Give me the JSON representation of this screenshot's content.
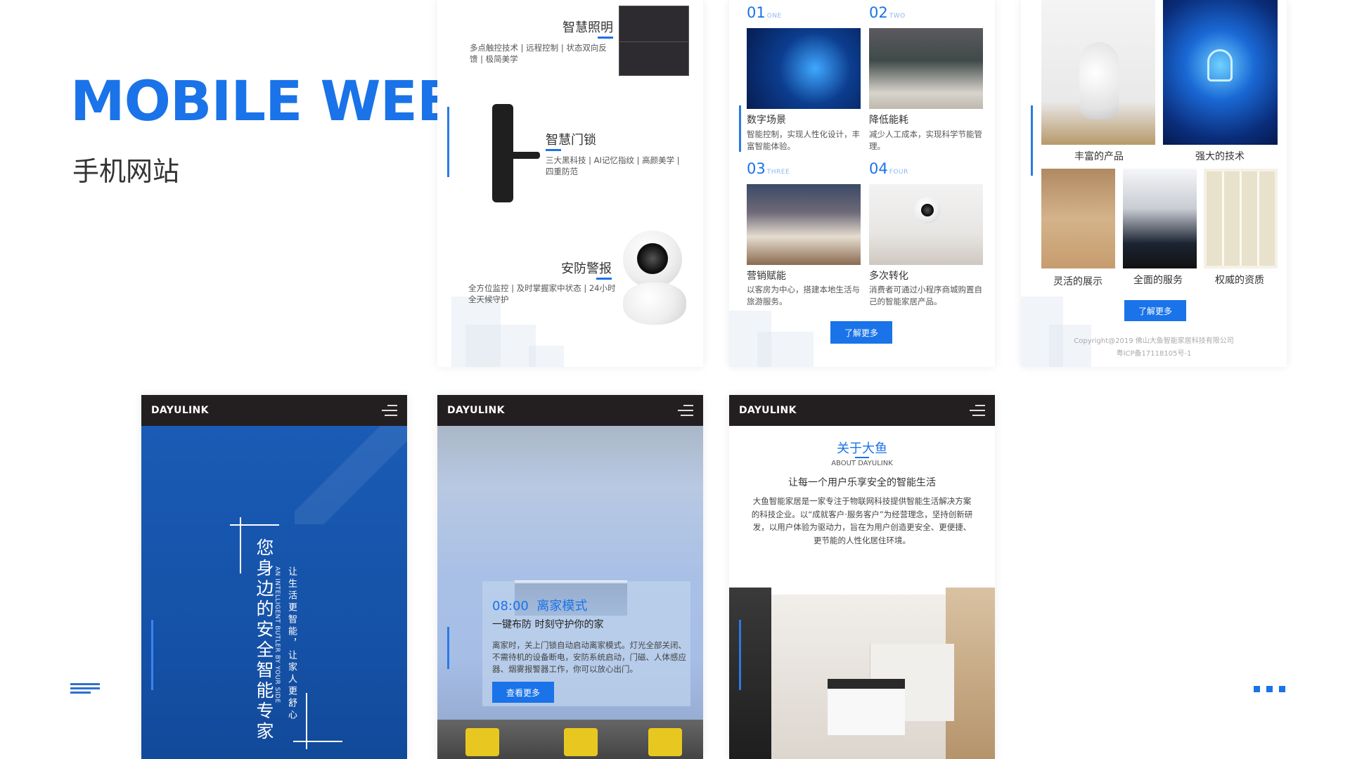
{
  "hero": {
    "title": "MOBILE WEB",
    "subtitle": "手机网站"
  },
  "products": [
    {
      "name": "智慧照明",
      "desc": "多点触控技术 | 远程控制 | 状态双向反馈 | 极简美学"
    },
    {
      "name": "智慧门锁",
      "desc": "三大黑科技 | AI记忆指纹 | 高颜美学 | 四重防范"
    },
    {
      "name": "安防警报",
      "desc": "全方位监控 | 及时掌握家中状态 | 24小时全天候守护"
    }
  ],
  "scenes": [
    {
      "num": "01",
      "tag": "ONE",
      "title": "数字场景",
      "desc": "智能控制，实现人性化设计，丰富智能体验。"
    },
    {
      "num": "02",
      "tag": "TWO",
      "title": "降低能耗",
      "desc": "减少人工成本，实现科学节能管理。"
    },
    {
      "num": "03",
      "tag": "THREE",
      "title": "营销赋能",
      "desc": "以客房为中心，搭建本地生活与旅游服务。"
    },
    {
      "num": "04",
      "tag": "FOUR",
      "title": "多次转化",
      "desc": "消费者可通过小程序商城购置自己的智能家居产品。"
    }
  ],
  "learn_more": "了解更多",
  "features": {
    "top": [
      "丰富的产品",
      "强大的技术"
    ],
    "bottom": [
      "灵活的展示",
      "全面的服务",
      "权威的资质"
    ]
  },
  "copyright": {
    "line1": "Copyright@2019 佛山大鱼智能家居科技有限公司",
    "line2": "粤ICP备17118105号-1"
  },
  "brand": "DAYULINK",
  "slogan": {
    "main": "您身边的安全智能专家",
    "en": "AN INTELLIGENT BUTLER BY YOUR SIDE",
    "side": "让生活更智能，让家人更舒心"
  },
  "away_mode": {
    "time": "08:00",
    "mode": "离家模式",
    "headline": "一键布防 时刻守护你的家",
    "desc": "离家时，关上门锁自动启动离家模式。灯光全部关闭、不需待机的设备断电，安防系统启动，门磁、人体感应器、烟雾报警器工作，你可以放心出门。",
    "button": "查看更多"
  },
  "about": {
    "title": "关于大鱼",
    "subtitle": "ABOUT DAYULINK",
    "tagline": "让每一个用户乐享安全的智能生活",
    "desc": "大鱼智能家居是一家专注于物联网科技提供智能生活解决方案的科技企业。以“成就客户·服务客户”为经营理念，坚持创新研发，以用户体验为驱动力，旨在为用户创造更安全、更便捷、更节能的人性化居住环境。"
  },
  "colors": {
    "accent": "#1a73e8",
    "navbar": "#231f20",
    "hero_blue": "#1552a8"
  }
}
